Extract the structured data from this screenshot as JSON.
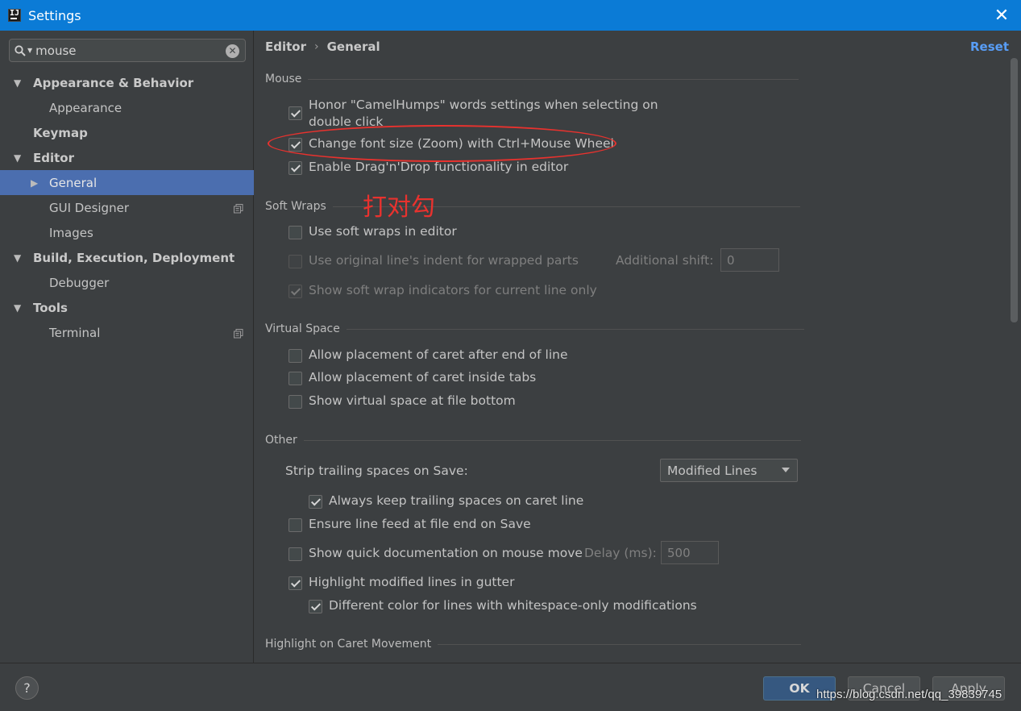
{
  "window": {
    "title": "Settings",
    "close_glyph": "✕"
  },
  "search": {
    "value": "mouse",
    "clear_glyph": "✕"
  },
  "tree": [
    {
      "label": "Appearance & Behavior",
      "arrow": "▼"
    },
    {
      "label": "Appearance"
    },
    {
      "label": "Keymap"
    },
    {
      "label": "Editor",
      "arrow": "▼"
    },
    {
      "label": "General",
      "arrow": "▶",
      "selected": true
    },
    {
      "label": "GUI Designer"
    },
    {
      "label": "Images"
    },
    {
      "label": "Build, Execution, Deployment",
      "arrow": "▼"
    },
    {
      "label": "Debugger"
    },
    {
      "label": "Tools",
      "arrow": "▼"
    },
    {
      "label": "Terminal"
    }
  ],
  "breadcrumb": {
    "first": "Editor",
    "sep": "›",
    "second": "General"
  },
  "reset_label": "Reset",
  "sections": {
    "mouse": "Mouse",
    "soft_wraps": "Soft Wraps",
    "virtual_space": "Virtual Space",
    "other": "Other",
    "highlight_caret": "Highlight on Caret Movement"
  },
  "mouse_options": [
    {
      "label_line1": "Honor \"CamelHumps\" words settings when selecting on",
      "label_line2": "double click",
      "checked": true
    },
    {
      "label": "Change font size (Zoom) with Ctrl+Mouse Wheel",
      "checked": true
    },
    {
      "label": "Enable Drag'n'Drop functionality in editor",
      "checked": true
    }
  ],
  "soft_wrap_options": [
    {
      "label": "Use soft wraps in editor",
      "checked": false
    },
    {
      "label": "Use original line's indent for wrapped parts",
      "checked": false,
      "disabled": true
    },
    {
      "label": "Show soft wrap indicators for current line only",
      "checked": true,
      "disabled": true
    }
  ],
  "additional_shift": {
    "label": "Additional shift:",
    "value": "0"
  },
  "virtual_space_options": [
    {
      "label": "Allow placement of caret after end of line",
      "checked": false
    },
    {
      "label": "Allow placement of caret inside tabs",
      "checked": false
    },
    {
      "label": "Show virtual space at file bottom",
      "checked": false
    }
  ],
  "other": {
    "strip_label": "Strip trailing spaces on Save:",
    "strip_value": "Modified Lines",
    "keep_trailing": {
      "label": "Always keep trailing spaces on caret line",
      "checked": true
    },
    "ensure_feed": {
      "label": "Ensure line feed at file end on Save",
      "checked": false
    },
    "quick_doc": {
      "label": "Show quick documentation on mouse move",
      "checked": false
    },
    "delay": {
      "label": "Delay (ms):",
      "value": "500"
    },
    "highlight_modified": {
      "label": "Highlight modified lines in gutter",
      "checked": true
    },
    "different_color": {
      "label": "Different color for lines with whitespace-only modifications",
      "checked": true
    }
  },
  "annotation": {
    "text": "打对勾",
    "color": "#e8322e"
  },
  "footer": {
    "help": "?",
    "ok": "OK",
    "cancel": "Cancel",
    "apply": "Apply",
    "watermark": "https://blog.csdn.net/qq_39839745"
  },
  "colors": {
    "titlebar": "#0b7bd6",
    "panel": "#3c3f41",
    "selection": "#4b6eaf",
    "link": "#589df6",
    "ok_button": "#365880"
  }
}
